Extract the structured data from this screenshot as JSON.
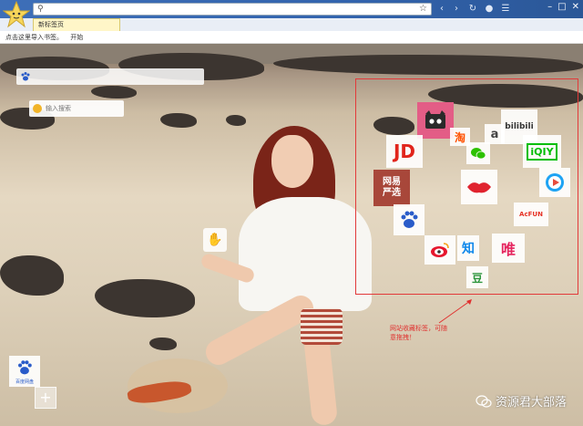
{
  "browser": {
    "tab_title": "新标签页",
    "bookmarks_hint": "点击这里导入书签。",
    "bookmarks_start": "开始"
  },
  "search": {
    "second_placeholder": "输入搜索"
  },
  "bookmark_tiles": [
    {
      "name": "tmall",
      "label": ""
    },
    {
      "name": "taobao",
      "label": "淘"
    },
    {
      "name": "acfun-a",
      "label": "a"
    },
    {
      "name": "bilibili",
      "label": "bilibili"
    },
    {
      "name": "jd",
      "label": "JD"
    },
    {
      "name": "wechat",
      "label": ""
    },
    {
      "name": "iqiyi",
      "label": "iQIY"
    },
    {
      "name": "netease-yanxuan",
      "label": "网易\n严选"
    },
    {
      "name": "lips",
      "label": ""
    },
    {
      "name": "youku",
      "label": ""
    },
    {
      "name": "acfun",
      "label": "AcFUN"
    },
    {
      "name": "baidu",
      "label": "du"
    },
    {
      "name": "weibo",
      "label": ""
    },
    {
      "name": "zhihu",
      "label": "知"
    },
    {
      "name": "vip",
      "label": "唯"
    },
    {
      "name": "douban",
      "label": "豆"
    }
  ],
  "bottom": {
    "baidu_label": "百度网盘"
  },
  "annotation": {
    "line1": "网站收藏标签，可随",
    "line2": "意拖拽！"
  },
  "watermark": {
    "text": "资源君大部落"
  },
  "colors": {
    "annotation_red": "#e0312f",
    "chrome_blue": "#3263ad"
  }
}
